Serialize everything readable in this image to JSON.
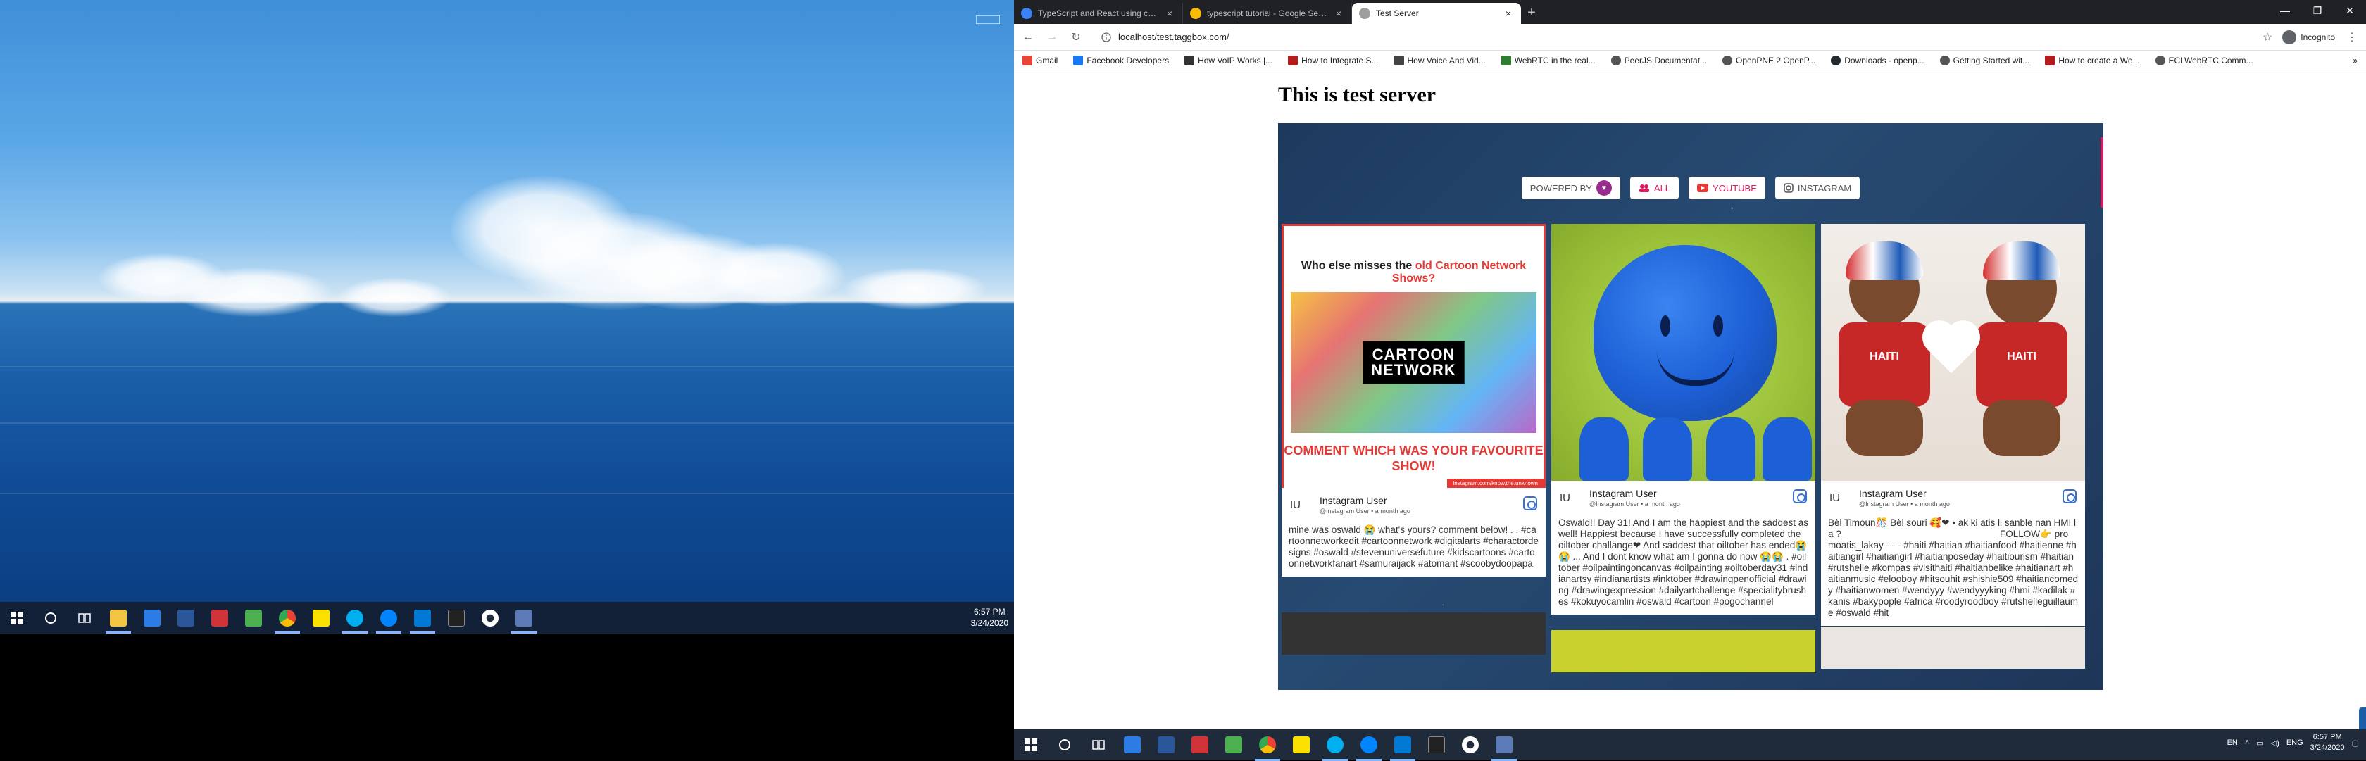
{
  "left_desktop": {
    "tray_icon_text": "",
    "taskbar": {
      "icons": [
        "start-icon",
        "cortana-icon",
        "task-view-icon",
        "file-explorer-icon",
        "mail-icon",
        "word-icon",
        "paint-icon",
        "snipping-icon",
        "chrome-icon",
        "sticky-icon",
        "skype-icon",
        "messenger-icon",
        "vscode-icon",
        "terminal-icon",
        "settings-icon",
        "remote-desktop-icon"
      ],
      "clock_time": "6:57 PM",
      "clock_date": "3/24/2020"
    }
  },
  "browser": {
    "tabs": [
      {
        "title": "TypeScript and React using crea...",
        "close": "×",
        "active": false,
        "fav_color": "#3b82f6"
      },
      {
        "title": "typescript tutorial - Google Sear...",
        "close": "×",
        "active": false,
        "fav_color": "#fbbc05"
      },
      {
        "title": "Test Server",
        "close": "×",
        "active": true,
        "fav_color": "#9e9e9e"
      }
    ],
    "new_tab": "+",
    "window_controls": [
      "—",
      "❐",
      "✕"
    ],
    "nav": {
      "back": "←",
      "forward": "→",
      "reload": "↻"
    },
    "url": "localhost/test.taggbox.com/",
    "profile_label": "Incognito",
    "bookmarks": [
      {
        "label": "Gmail",
        "color": "#ea4335"
      },
      {
        "label": "Facebook Developers",
        "color": "#1877f2"
      },
      {
        "label": "How VoIP Works |...",
        "color": "#333333"
      },
      {
        "label": "How to Integrate S...",
        "color": "#b71c1c"
      },
      {
        "label": "How Voice And Vid...",
        "color": "#444444"
      },
      {
        "label": "WebRTC in the real...",
        "color": "#2e7d32"
      },
      {
        "label": "PeerJS Documentat...",
        "color": "#555555"
      },
      {
        "label": "OpenPNE 2 OpenP...",
        "color": "#555555"
      },
      {
        "label": "Downloads · openp...",
        "color": "#24292e"
      },
      {
        "label": "Getting Started wit...",
        "color": "#555555"
      },
      {
        "label": "How to create a We...",
        "color": "#b71c1c"
      },
      {
        "label": "ECLWebRTC Comm...",
        "color": "#555555"
      }
    ],
    "bookmarks_more": "»"
  },
  "page": {
    "heading": "This is test server",
    "filters": {
      "powered_by": "POWERED BY",
      "all": "ALL",
      "youtube": "YOUTUBE",
      "instagram": "INSTAGRAM"
    },
    "cards": [
      {
        "initials": "IU",
        "user": "Instagram User",
        "sub": "@Instagram User  • a month ago",
        "media": {
          "title_prefix": "Who else misses the ",
          "title_red": "old Cartoon Network Shows?",
          "logo_line1": "CARTOON",
          "logo_line2": "NETWORK",
          "comment": "COMMENT WHICH WAS YOUR FAVOURITE SHOW!",
          "footer": "instagram.com/know.the.unknown"
        },
        "caption": "mine was oswald 😭 what's yours? comment below! . . #cartoonnetworkedit #cartoonnetwork #digitalarts #charactordesigns #oswald #stevenuniversefuture #kidscartoons #cartoonnetworkfanart #samuraijack #atomant #scoobydoopapa"
      },
      {
        "initials": "IU",
        "user": "Instagram User",
        "sub": "@Instagram User  • a month ago",
        "caption": "Oswald!! Day 31! And I am the happiest and the saddest as well! Happiest because I have successfully completed the oiltober challange❤ And saddest that oiltober has ended😭😭 ... And I dont know what am I gonna do now 😭😭 . #oiltober #oilpaintingoncanvas #oilpainting #oiltoberday31 #indianartsy #indianartists #inktober #drawingpenofficial #drawing #drawingexpression #dailyartchallenge #specialitybrushes #kokuyocamlin #oswald #cartoon #pogochannel"
      },
      {
        "initials": "IU",
        "user": "Instagram User",
        "sub": "@Instagram User  • a month ago",
        "media": {
          "shirt_left": "HAITI",
          "shirt_right": "HAITI"
        },
        "caption": "Bèl Timoun🎊 Bèl souri 🥰❤ • ak ki atis li sanble nan HMI la ? _____________________________ FOLLOW👉 pro moatis_lakay - - - #haiti #haitian #haitianfood #haitienne #haitiangirl #haitiangirl #haitianposeday #haitiourism #haitian #rutshelle #kompas #visithaiti #haitianbelike #haitianart #haitianmusic #elooboy #hitsouhit #shishie509 #haitiancomedy #haitianwomen #wendyyy #wendyyyking #hmi #kadilak #kanis #bakypople #africa #roodyroodboy #rutshelleguillaume #oswald #hit"
      }
    ]
  },
  "right_taskbar": {
    "icons": [
      "start-icon",
      "cortana-icon",
      "task-view-icon",
      "mail-icon",
      "word-icon",
      "paint-icon",
      "snipping-icon",
      "chrome-icon",
      "sticky-icon",
      "skype-icon",
      "messenger-icon",
      "vscode-icon",
      "terminal-icon",
      "settings-icon",
      "remote-desktop-icon"
    ],
    "lang1": "EN",
    "lang2": "ENG",
    "clock_time": "6:57 PM",
    "clock_date": "3/24/2020"
  }
}
